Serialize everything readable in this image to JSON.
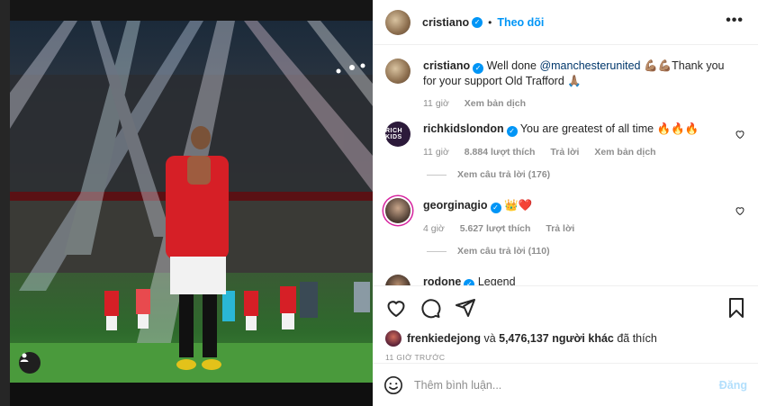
{
  "post": {
    "author": "cristiano",
    "follow_label": "Theo dõi",
    "more_label": "•••",
    "caption": {
      "user": "cristiano",
      "text_before": "Well done ",
      "mention": "@manchesterunited",
      "text_after": " 💪🏽💪🏽Thank you for your support Old Trafford 🙏🏽",
      "time": "11 giờ",
      "translate": "Xem bản dịch"
    },
    "comments": [
      {
        "user": "richkidslondon",
        "avatar_text": "RICH KIDS",
        "text": "You are greatest of all time 🔥🔥🔥",
        "time": "11 giờ",
        "likes": "8.884 lượt thích",
        "reply": "Trả lời",
        "translate": "Xem bản dịch",
        "view_replies": "Xem câu trả lời (176)"
      },
      {
        "user": "georginagio",
        "text": "👑❤️",
        "time": "4 giờ",
        "likes": "5.627 lượt thích",
        "reply": "Trả lời",
        "view_replies": "Xem câu trả lời (110)"
      },
      {
        "user": "rodone",
        "text": "Legend"
      }
    ],
    "liked_by": "frenkiedejong",
    "liked_and": " và ",
    "liked_others": "5,476,137 người khác",
    "liked_suffix": " đã thích",
    "timestamp": "11 GIỜ TRƯỚC",
    "comment_placeholder": "Thêm bình luận...",
    "post_button": "Đăng"
  },
  "icons": [
    "heart-icon",
    "comment-icon",
    "share-icon",
    "bookmark-icon",
    "emoji-icon",
    "user-tag-icon",
    "verified-icon",
    "more-icon"
  ],
  "colors": {
    "accent": "#0095f6",
    "pitch": "#3f8b37",
    "jersey": "#d61f26"
  }
}
